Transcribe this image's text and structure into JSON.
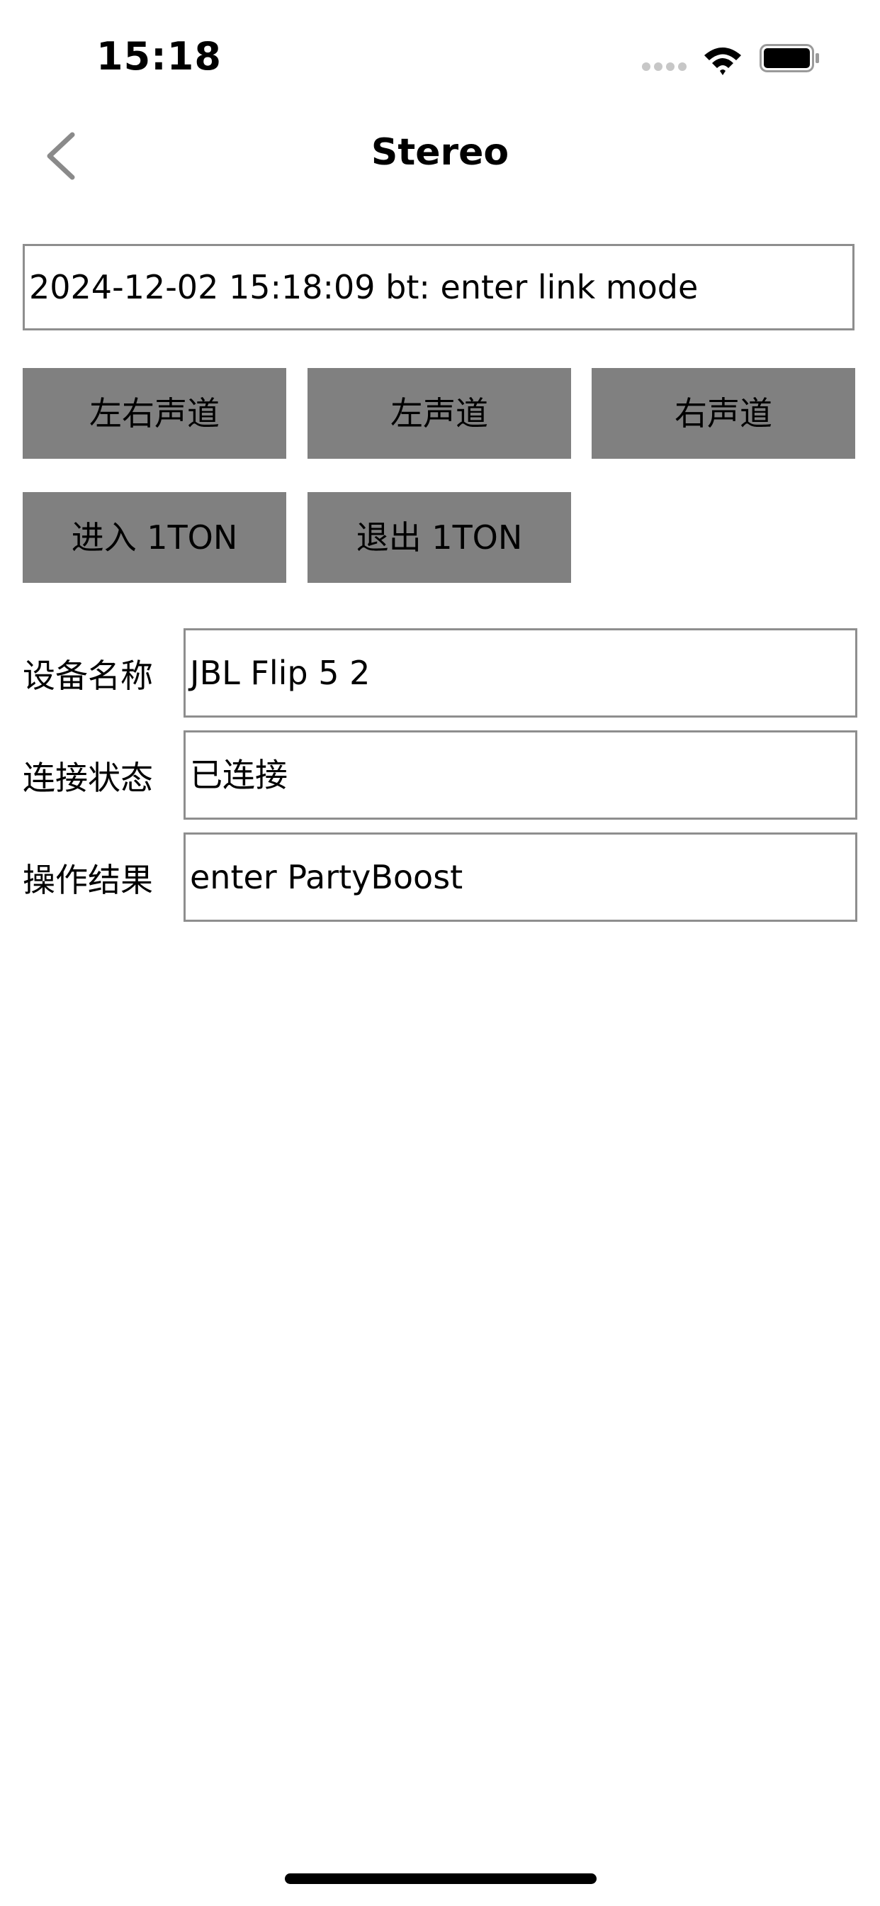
{
  "status_bar": {
    "time": "15:18"
  },
  "nav": {
    "title": "Stereo"
  },
  "log": {
    "text": "2024-12-02 15:18:09 bt: enter link mode"
  },
  "buttons": {
    "stereo": "左右声道",
    "left": "左声道",
    "right": "右声道",
    "enter": "进入 1TON",
    "exit": "退出 1TON"
  },
  "form": {
    "device_name": {
      "label": "设备名称",
      "value": "JBL Flip 5 2"
    },
    "connection_status": {
      "label": "连接状态",
      "value": "已连接"
    },
    "operation_result": {
      "label": "操作结果",
      "value": "enter PartyBoost"
    }
  },
  "colors": {
    "button_bg": "#808080",
    "field_border": "#8e8e8e",
    "back_chevron": "#8a8a8a"
  }
}
